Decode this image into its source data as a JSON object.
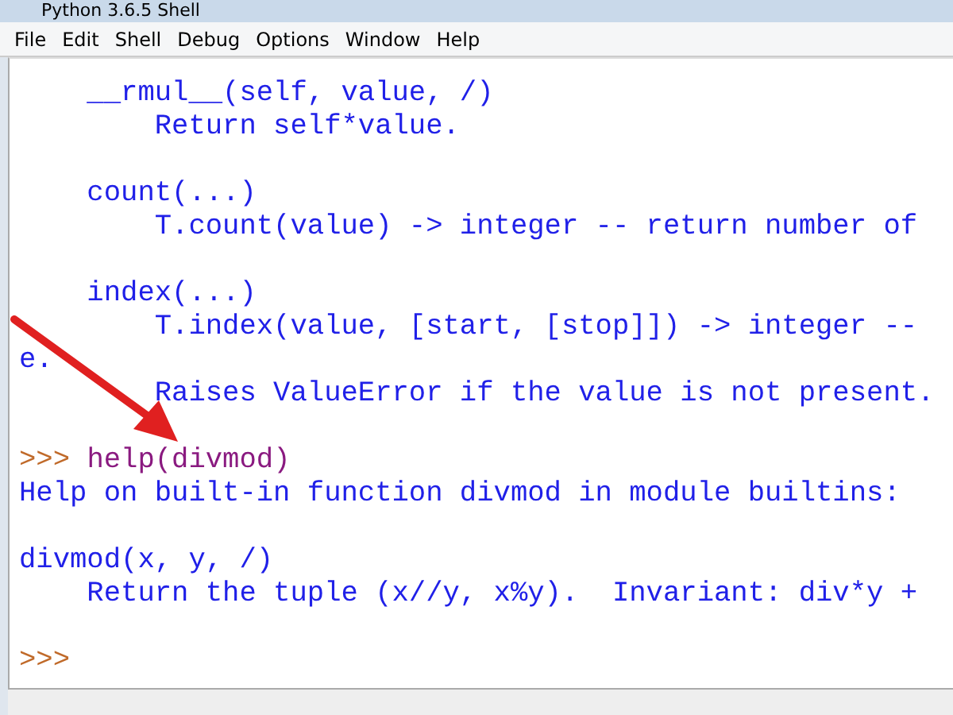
{
  "window": {
    "title": "Python 3.6.5 Shell"
  },
  "menu": [
    "File",
    "Edit",
    "Shell",
    "Debug",
    "Options",
    "Window",
    "Help"
  ],
  "lines": [
    {
      "kind": "output",
      "text": "    __rmul__(self, value, /)"
    },
    {
      "kind": "output",
      "text": "        Return self*value."
    },
    {
      "kind": "blank"
    },
    {
      "kind": "output",
      "text": "    count(...)"
    },
    {
      "kind": "output",
      "text": "        T.count(value) -> integer -- return number of"
    },
    {
      "kind": "blank"
    },
    {
      "kind": "output",
      "text": "    index(...)"
    },
    {
      "kind": "output",
      "text": "        T.index(value, [start, [stop]]) -> integer --"
    },
    {
      "kind": "output",
      "text": "e."
    },
    {
      "kind": "output",
      "text": "        Raises ValueError if the value is not present."
    },
    {
      "kind": "blank"
    },
    {
      "kind": "input",
      "prompt": ">>>",
      "command": "help(divmod)"
    },
    {
      "kind": "output",
      "text": "Help on built-in function divmod in module builtins:"
    },
    {
      "kind": "blank"
    },
    {
      "kind": "output",
      "text": "divmod(x, y, /)"
    },
    {
      "kind": "output",
      "text": "    Return the tuple (x//y, x%y).  Invariant: div*y +"
    },
    {
      "kind": "blank"
    },
    {
      "kind": "input",
      "prompt": ">>>"
    }
  ]
}
